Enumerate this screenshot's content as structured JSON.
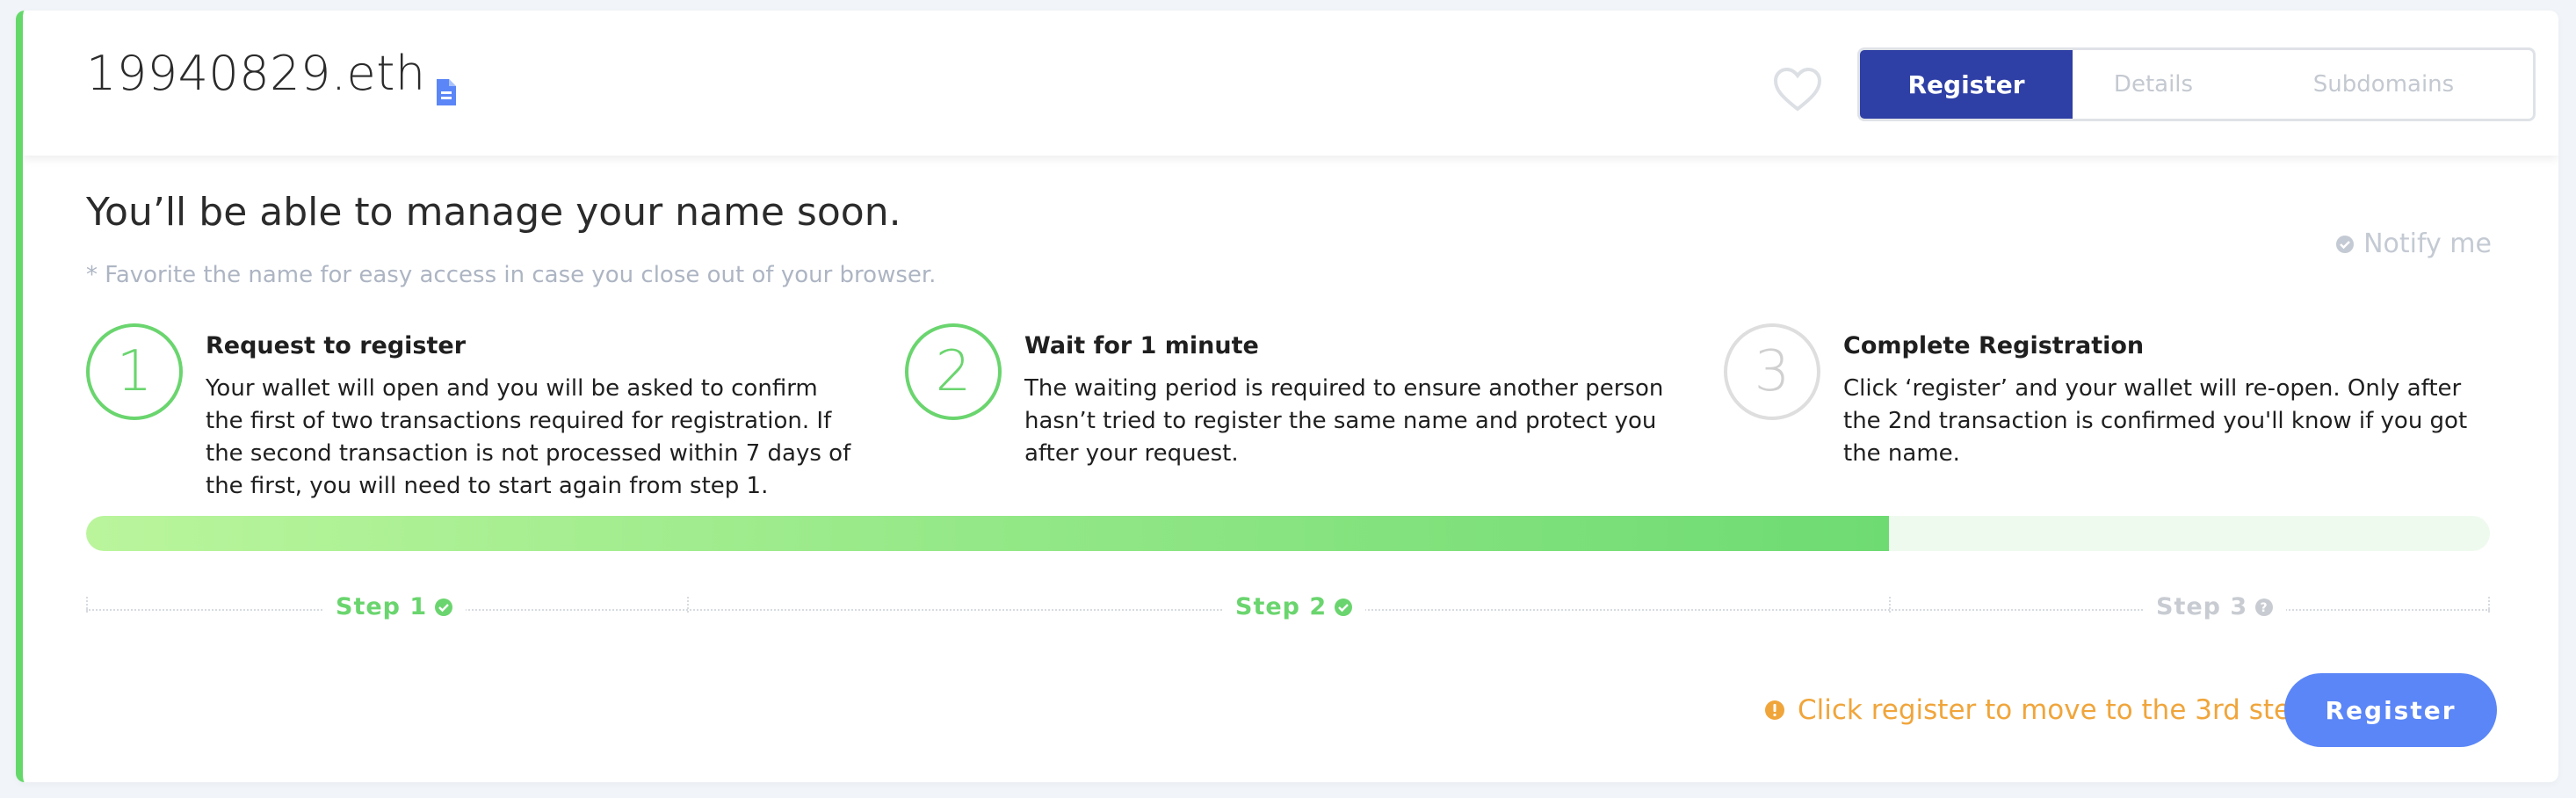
{
  "header": {
    "domain": "19940829.eth",
    "tabs": [
      {
        "label": "Register",
        "active": true
      },
      {
        "label": "Details",
        "active": false
      },
      {
        "label": "Subdomains",
        "active": false
      }
    ]
  },
  "main": {
    "title": "You’ll be able to manage your name soon.",
    "subtitle": "* Favorite the name for easy access in case you close out of your browser.",
    "notify_label": "Notify me",
    "steps": [
      {
        "number": "1",
        "title": "Request to register",
        "description": "Your wallet will open and you will be asked to confirm the first of two transactions required for registration. If the second transaction is not processed within 7 days of the first, you will need to start again from step 1.",
        "status": "complete"
      },
      {
        "number": "2",
        "title": "Wait for 1 minute",
        "description": "The waiting period is required to ensure another person hasn’t tried to register the same name and protect you after your request.",
        "status": "complete"
      },
      {
        "number": "3",
        "title": "Complete Registration",
        "description": "Click ‘register’ and your wallet will re-open. Only after the 2nd transaction is confirmed you'll know if you got the name.",
        "status": "pending"
      }
    ],
    "progress_fraction": 0.75,
    "timeline": [
      {
        "label": "Step 1",
        "icon": "check-circle-icon",
        "status": "done"
      },
      {
        "label": "Step 2",
        "icon": "check-circle-icon",
        "status": "done"
      },
      {
        "label": "Step 3",
        "icon": "question-circle-icon",
        "status": "todo"
      }
    ],
    "cta_note": "Click register to move to the 3rd step",
    "register_button": "Register"
  },
  "colors": {
    "accent_green": "#6ad56e",
    "primary_blue": "#2e3fa5",
    "button_blue": "#5b86f7",
    "warning_orange": "#f0a53b"
  }
}
